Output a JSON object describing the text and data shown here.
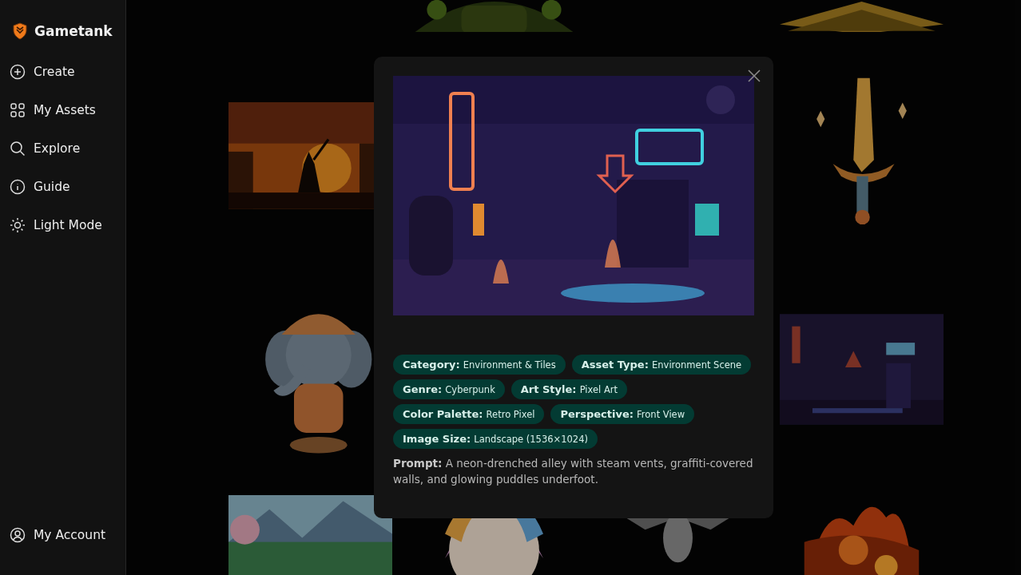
{
  "brand": {
    "name": "Gametank"
  },
  "nav": [
    {
      "label": "Create"
    },
    {
      "label": "My Assets"
    },
    {
      "label": "Explore"
    },
    {
      "label": "Guide"
    },
    {
      "label": "Light Mode"
    }
  ],
  "account": {
    "label": "My Account"
  },
  "modal": {
    "tags": [
      {
        "label": "Category:",
        "value": "Environment & Tiles"
      },
      {
        "label": "Asset Type:",
        "value": "Environment Scene"
      },
      {
        "label": "Genre:",
        "value": "Cyberpunk"
      },
      {
        "label": "Art Style:",
        "value": "Pixel Art"
      },
      {
        "label": "Color Palette:",
        "value": "Retro Pixel"
      },
      {
        "label": "Perspective:",
        "value": "Front View"
      },
      {
        "label": "Image Size:",
        "value": "Landscape (1536×1024)"
      }
    ],
    "prompt": "**Prompt:** A neon-drenched alley with steam vents, graffiti-covered walls, and glowing puddles underfoot."
  }
}
